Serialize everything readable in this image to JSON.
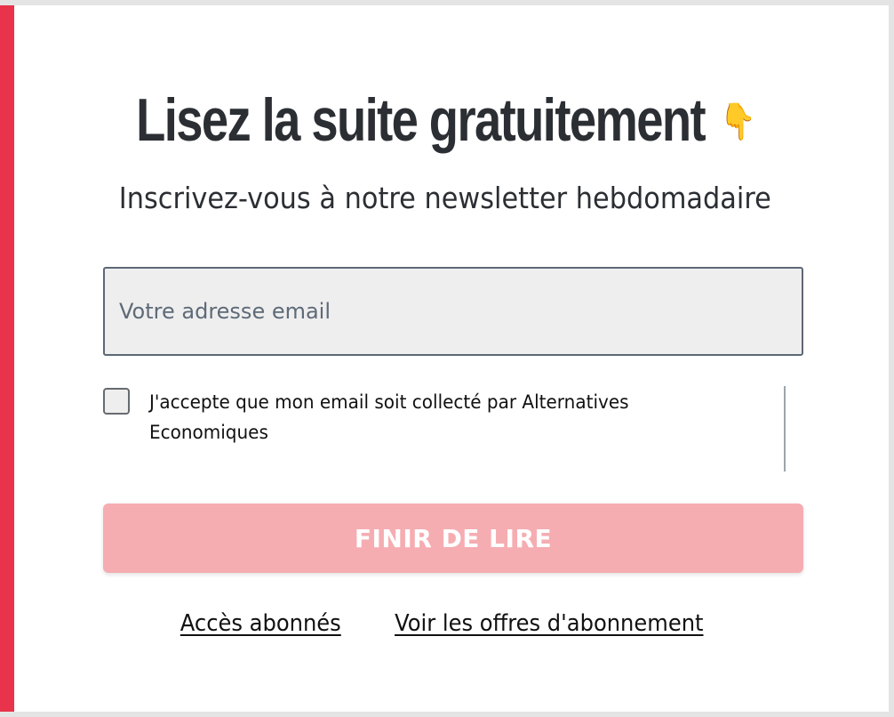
{
  "modal": {
    "headline": "Lisez la suite gratuitement",
    "headline_emoji": "👇",
    "subtitle": "Inscrivez-vous à notre newsletter hebdomadaire",
    "email": {
      "placeholder": "Votre adresse email",
      "value": ""
    },
    "consent": {
      "checked": false,
      "label": "J'accepte que mon email soit collecté par Alternatives Economiques"
    },
    "submit_label": "FINIR DE LIRE",
    "links": {
      "subscriber_access": "Accès abonnés",
      "subscription_offers": "Voir les offres d'abonnement"
    }
  },
  "colors": {
    "accent": "#e8334a",
    "button_disabled": "#f5adb2",
    "text_dark": "#2b2f33"
  },
  "icons": {
    "headline_emoji": "pointing-down-hand-icon"
  }
}
